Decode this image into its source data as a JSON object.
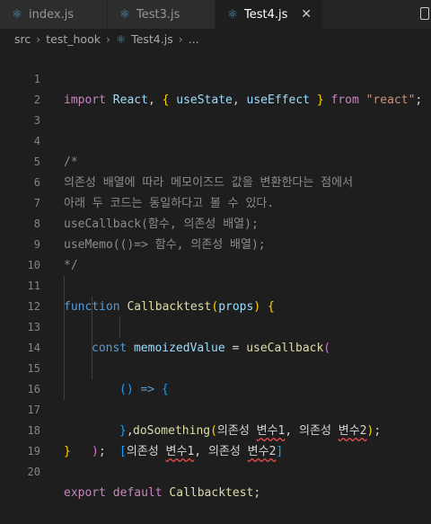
{
  "tabs": [
    {
      "label": "index.js",
      "icon": "react-icon"
    },
    {
      "label": "Test3.js",
      "icon": "react-icon"
    },
    {
      "label": "Test4.js",
      "icon": "react-icon",
      "active": true
    }
  ],
  "close_glyph": "✕",
  "breadcrumb": {
    "parts": [
      "src",
      "test_hook",
      "Test4.js",
      "..."
    ]
  },
  "lines": [
    {
      "n": "1"
    },
    {
      "n": "2"
    },
    {
      "n": "3"
    },
    {
      "n": "4"
    },
    {
      "n": "5"
    },
    {
      "n": "6"
    },
    {
      "n": "7"
    },
    {
      "n": "8"
    },
    {
      "n": "9"
    },
    {
      "n": "10"
    },
    {
      "n": "11"
    },
    {
      "n": "12"
    },
    {
      "n": "13"
    },
    {
      "n": "14"
    },
    {
      "n": "15"
    },
    {
      "n": "16"
    },
    {
      "n": "17"
    },
    {
      "n": "18"
    },
    {
      "n": "19"
    },
    {
      "n": "20"
    }
  ],
  "code": {
    "l1": {
      "import": "import",
      "react": "React",
      "comma": ",",
      "ob": "{",
      "us": "useState",
      "c2": ",",
      "ue": "useEffect",
      "cb": "}",
      "from": "from",
      "str": "\"react\"",
      "semi": ";"
    },
    "l3": "/*",
    "l4": "의존성 배열에 따라 메모이즈드 값을 변환한다는 점에서",
    "l5": "아래 두 코드는 동일하다고 볼 수 있다.",
    "l6": "useCallback(함수, 의존성 배열);",
    "l7": "useMemo(()=> 함수, 의존성 배열);",
    "l8": "*/",
    "l10": {
      "function": "function",
      "name": "Callbacktest",
      "op": "(",
      "props": "props",
      "cp": ")",
      "ob": "{"
    },
    "l11": {
      "const": "const",
      "var": "memoizedValue",
      "eq": "=",
      "fn": "useCallback",
      "op": "("
    },
    "l12": {
      "op": "()",
      "arrow": "=>",
      "ob": "{"
    },
    "l13": {
      "fn": "doSomething",
      "op": "(",
      "a": "의존성",
      "b": "변수1",
      "c": ",",
      "d": "의존성",
      "e": "변수2",
      "cp": ")",
      "semi": ";"
    },
    "l14": {
      "cb": "}",
      "c": ","
    },
    "l15": {
      "ob": "[",
      "a": "의존성",
      "b": "변수1",
      "c": ",",
      "d": "의존성",
      "e": "변수2",
      "cb": "]"
    },
    "l16": {
      "cp": ")",
      "semi": ";"
    },
    "l17": {
      "cb": "}"
    },
    "l19": {
      "export": "export",
      "default": "default",
      "name": "Callbacktest",
      "semi": ";"
    }
  }
}
